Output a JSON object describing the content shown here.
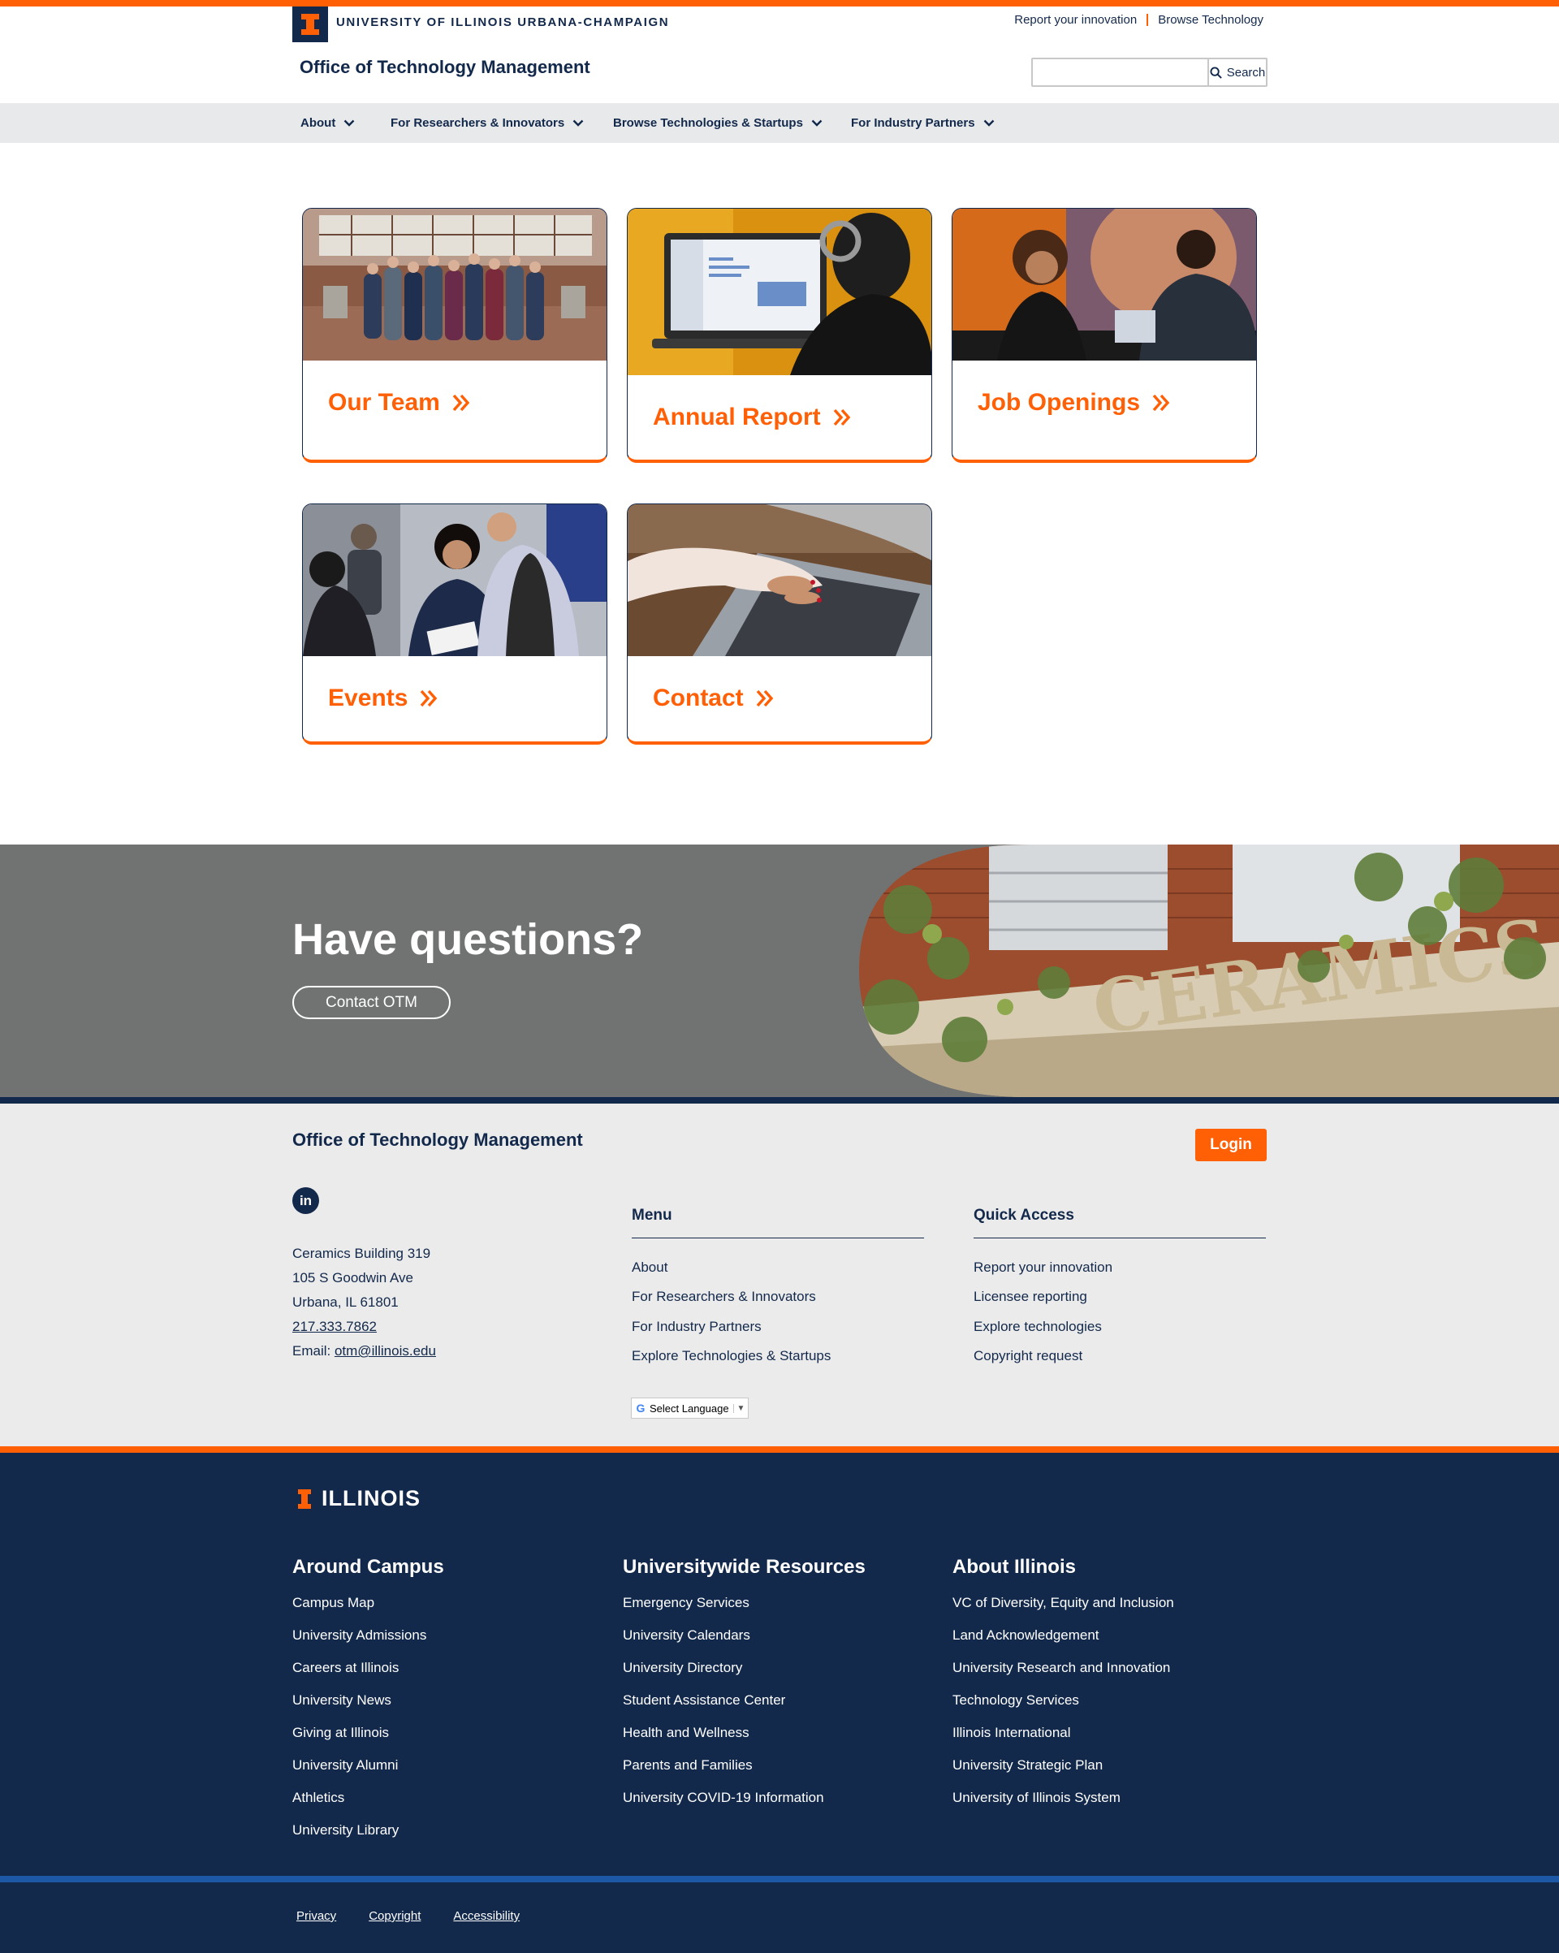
{
  "brand": {
    "university": "UNIVERSITY OF ILLINOIS URBANA-CHAMPAIGN",
    "site_title": "Office of Technology Management",
    "colors": {
      "orange": "#ff5f05",
      "navy": "#13294b",
      "gray_band": "#707372",
      "light_gray": "#ebebeb"
    }
  },
  "utility": {
    "report": "Report your innovation",
    "browse": "Browse Technology"
  },
  "search": {
    "placeholder": "",
    "button": "Search"
  },
  "nav": {
    "items": [
      {
        "label": "About"
      },
      {
        "label": "For Researchers & Innovators"
      },
      {
        "label": "Browse Technologies & Startups"
      },
      {
        "label": "For Industry Partners"
      }
    ]
  },
  "cards": [
    {
      "title": "Our Team",
      "image": "team-group-photo"
    },
    {
      "title": "Annual Report",
      "image": "laptop-spreadsheet-photo"
    },
    {
      "title": "Job Openings",
      "image": "interview-photo"
    },
    {
      "title": "Events",
      "image": "networking-event-photo"
    },
    {
      "title": "Contact",
      "image": "typing-laptop-photo"
    }
  ],
  "cta": {
    "title": "Have questions?",
    "button": "Contact OTM",
    "image": "ceramics-building-facade-photo"
  },
  "unit_footer": {
    "title": "Office of Technology Management",
    "login": "Login",
    "social": "linkedin-icon",
    "address": [
      "Ceramics Building 319",
      "105 S Goodwin Ave",
      "Urbana, IL 61801"
    ],
    "phone": "217.333.7862",
    "email_label": "Email: ",
    "email": "otm@illinois.edu",
    "menu": {
      "title": "Menu",
      "items": [
        "About",
        "For Researchers & Innovators",
        "For Industry Partners",
        "Explore Technologies & Startups"
      ]
    },
    "quick": {
      "title": "Quick Access",
      "items": [
        "Report your innovation",
        "Licensee reporting",
        "Explore technologies",
        "Copyright request"
      ]
    },
    "language": "Select Language"
  },
  "campus_footer": {
    "logo": "ILLINOIS",
    "columns": [
      {
        "title": "Around Campus",
        "items": [
          "Campus Map",
          "University Admissions",
          "Careers at Illinois",
          "University News",
          "Giving at Illinois",
          "University Alumni",
          "Athletics",
          "University Library"
        ]
      },
      {
        "title": "Universitywide Resources",
        "items": [
          "Emergency Services",
          "University Calendars",
          "University Directory",
          "Student Assistance Center",
          "Health and Wellness",
          "Parents and Families",
          "University COVID-19 Information"
        ]
      },
      {
        "title": "About Illinois",
        "items": [
          "VC of Diversity, Equity and Inclusion",
          "Land Acknowledgement",
          "University Research and Innovation",
          "Technology Services",
          "Illinois International",
          "University Strategic Plan",
          "University of Illinois System"
        ]
      }
    ],
    "legal": [
      "Privacy",
      "Copyright",
      "Accessibility"
    ]
  }
}
